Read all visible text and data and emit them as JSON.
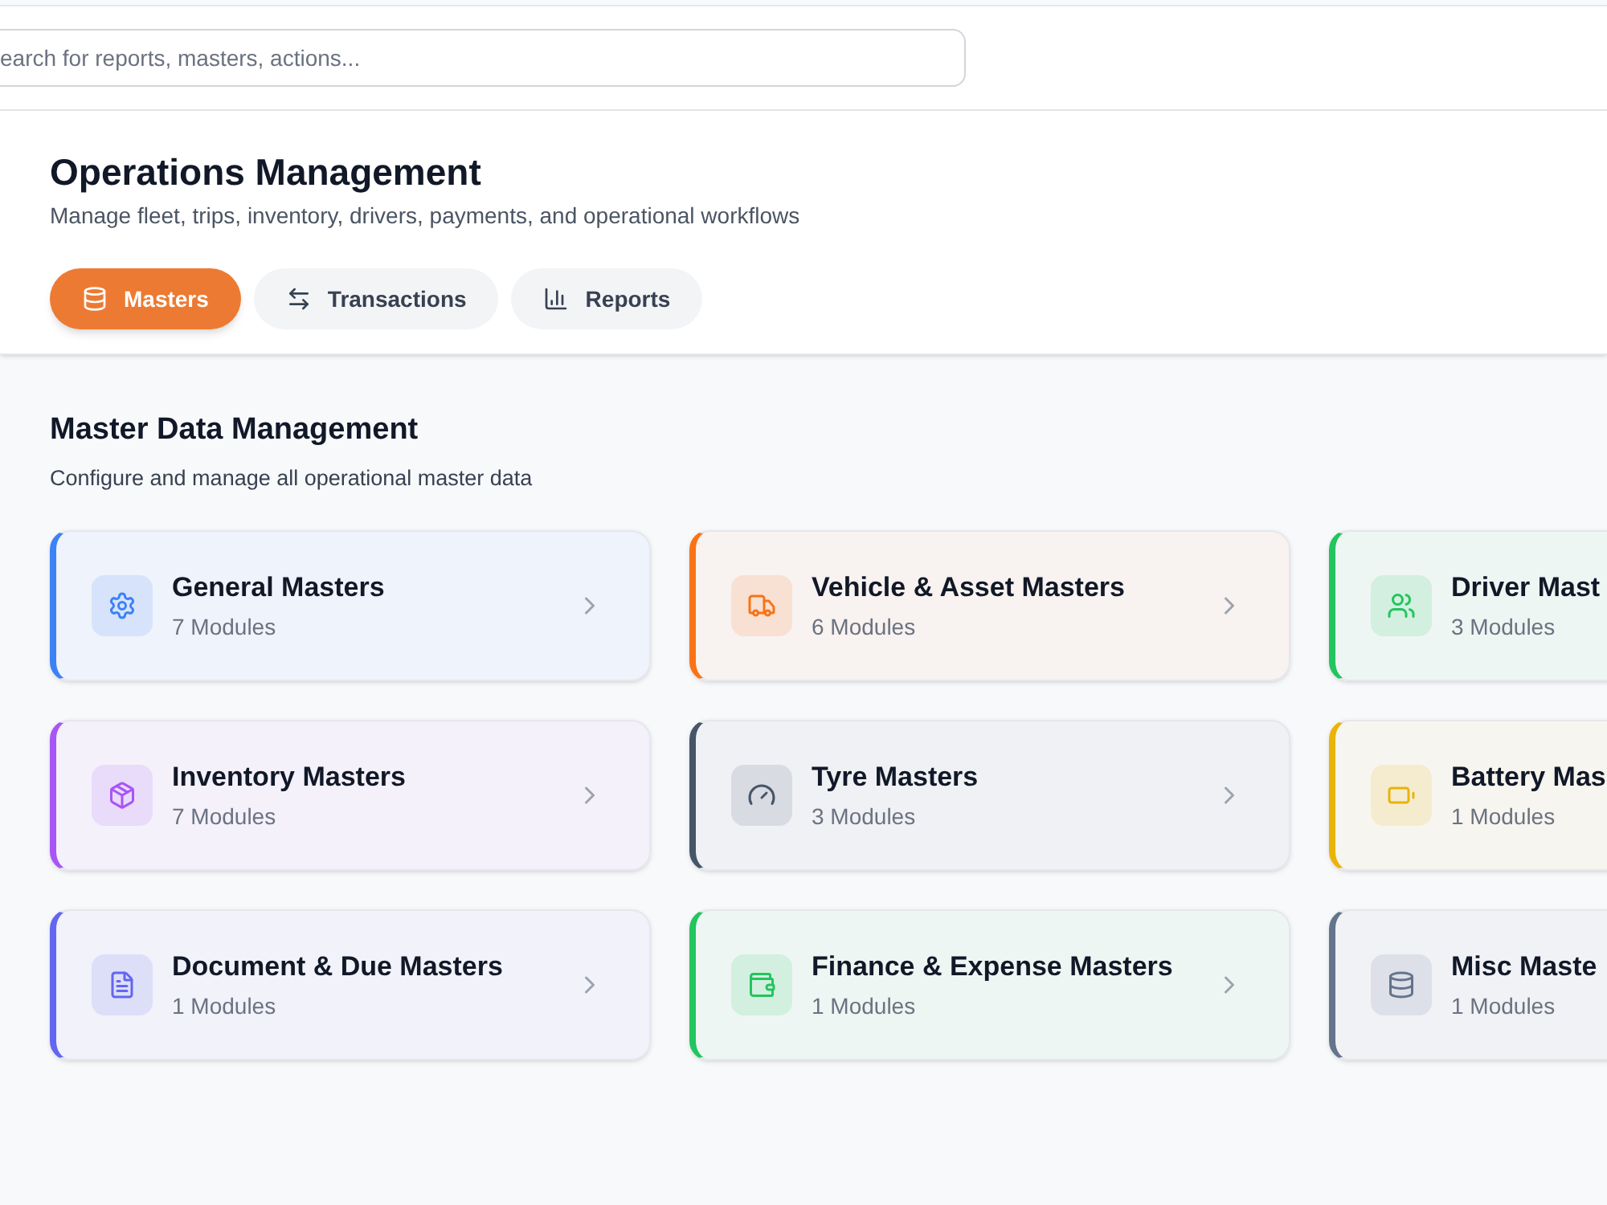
{
  "search": {
    "placeholder": "earch for reports, masters, actions..."
  },
  "header": {
    "title": "Operations Management",
    "subtitle": "Manage fleet, trips, inventory, drivers, payments, and operational workflows"
  },
  "tabs": [
    {
      "label": "Masters",
      "kind": "database",
      "selected": true
    },
    {
      "label": "Transactions",
      "kind": "arrows",
      "selected": false
    },
    {
      "label": "Reports",
      "kind": "chart",
      "selected": false
    }
  ],
  "section": {
    "title": "Master Data Management",
    "subtitle": "Configure and manage all operational master data"
  },
  "cards": [
    {
      "title": "General Masters",
      "count": "7 Modules",
      "kind": "gear",
      "color": "#3b82f6"
    },
    {
      "title": "Vehicle & Asset Masters",
      "count": "6 Modules",
      "kind": "truck",
      "color": "#f97316"
    },
    {
      "title": "Driver Mast",
      "count": "3 Modules",
      "kind": "users",
      "color": "#22c55e"
    },
    {
      "title": "Inventory Masters",
      "count": "7 Modules",
      "kind": "package",
      "color": "#a855f7"
    },
    {
      "title": "Tyre Masters",
      "count": "3 Modules",
      "kind": "gauge",
      "color": "#475569"
    },
    {
      "title": "Battery Mas",
      "count": "1 Modules",
      "kind": "battery",
      "color": "#eab308"
    },
    {
      "title": "Document & Due Masters",
      "count": "1 Modules",
      "kind": "file",
      "color": "#6366f1"
    },
    {
      "title": "Finance & Expense Masters",
      "count": "1 Modules",
      "kind": "wallet",
      "color": "#22c55e"
    },
    {
      "title": "Misc Maste",
      "count": "1 Modules",
      "kind": "database",
      "color": "#64748b"
    }
  ]
}
